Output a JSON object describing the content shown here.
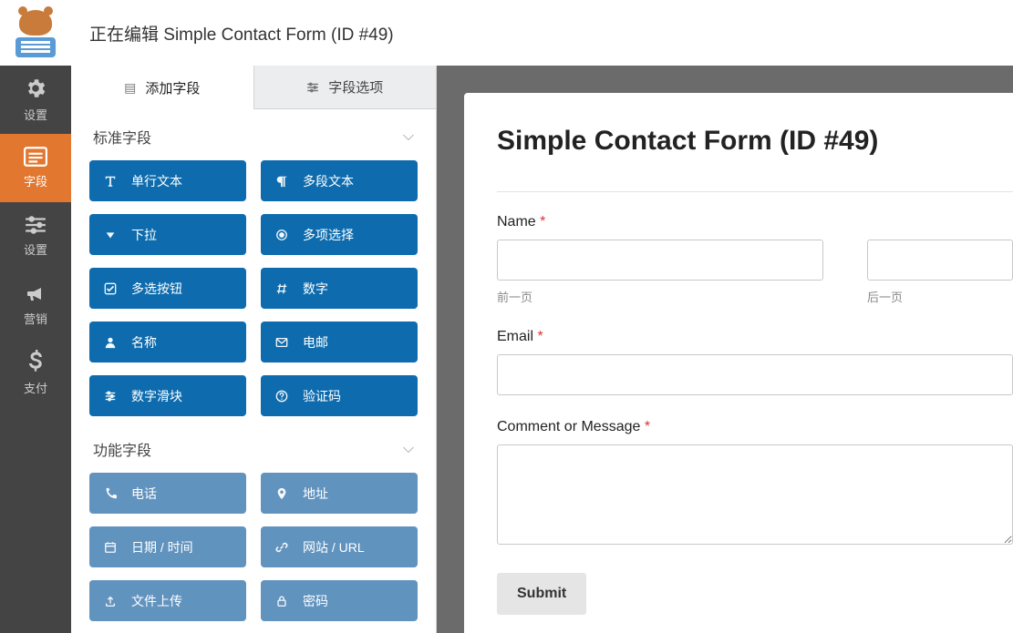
{
  "header": {
    "title": "正在编辑 Simple Contact Form (ID #49)"
  },
  "rail": [
    {
      "label": "设置",
      "icon": "gear",
      "active": false
    },
    {
      "label": "字段",
      "icon": "form",
      "active": true
    },
    {
      "label": "设置",
      "icon": "sliders",
      "active": false
    },
    {
      "label": "营销",
      "icon": "bullhorn",
      "active": false
    },
    {
      "label": "支付",
      "icon": "dollar",
      "active": false
    }
  ],
  "tabs": {
    "add_fields": "添加字段",
    "field_options": "字段选项"
  },
  "sections": {
    "standard": "标准字段",
    "functional": "功能字段"
  },
  "standard_fields": [
    {
      "label": "单行文本",
      "icon": "text"
    },
    {
      "label": "多段文本",
      "icon": "paragraph"
    },
    {
      "label": "下拉",
      "icon": "caret"
    },
    {
      "label": "多项选择",
      "icon": "radio"
    },
    {
      "label": "多选按钮",
      "icon": "check"
    },
    {
      "label": "数字",
      "icon": "hash"
    },
    {
      "label": "名称",
      "icon": "user"
    },
    {
      "label": "电邮",
      "icon": "mail"
    },
    {
      "label": "数字滑块",
      "icon": "sliders"
    },
    {
      "label": "验证码",
      "icon": "question"
    }
  ],
  "functional_fields": [
    {
      "label": "电话",
      "icon": "phone"
    },
    {
      "label": "地址",
      "icon": "pin"
    },
    {
      "label": "日期 / 时间",
      "icon": "calendar"
    },
    {
      "label": "网站 / URL",
      "icon": "link"
    },
    {
      "label": "文件上传",
      "icon": "upload"
    },
    {
      "label": "密码",
      "icon": "lock"
    }
  ],
  "preview": {
    "form_title": "Simple Contact Form (ID #49)",
    "name_label": "Name",
    "first_sub": "前一页",
    "last_sub": "后一页",
    "email_label": "Email",
    "comment_label": "Comment or Message",
    "submit": "Submit"
  }
}
